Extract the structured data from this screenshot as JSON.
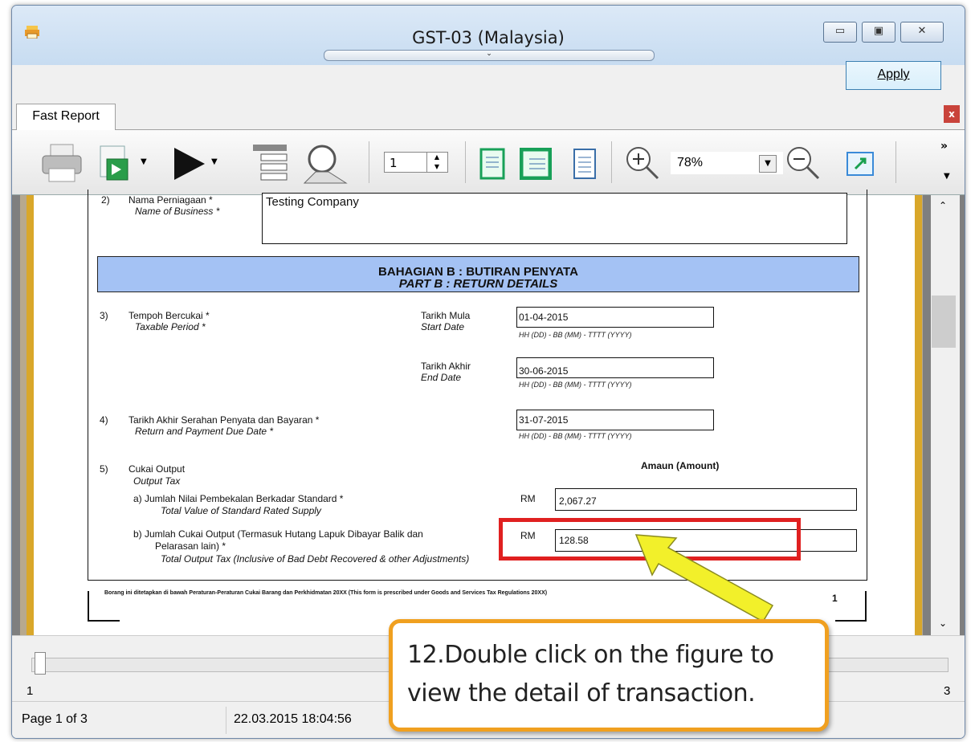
{
  "window": {
    "title": "GST-03 (Malaysia)",
    "minimize": "▭",
    "maximize": "▣",
    "close": "✕"
  },
  "commands": {
    "apply": "Apply"
  },
  "tabs": {
    "active": "Fast Report",
    "close": "x"
  },
  "toolbar": {
    "page_input": "1",
    "zoom": "78%",
    "spin_up": "▲",
    "spin_down": "▼",
    "zoom_dropdown": "▼",
    "overflow": "»",
    "overflow_down": "▼"
  },
  "form": {
    "item2_num": "2)",
    "item2_label_ms": "Nama Perniagaan *",
    "item2_label_en": "Name of Business *",
    "item2_value": "Testing Company",
    "partb_ms": "BAHAGIAN B : BUTIRAN PENYATA",
    "partb_en": "PART B : RETURN DETAILS",
    "item3_num": "3)",
    "item3_label_ms": "Tempoh Bercukai *",
    "item3_label_en": "Taxable Period *",
    "start_label_ms": "Tarikh Mula",
    "start_label_en": "Start Date",
    "start_value": "01-04-2015",
    "date_hint": "HH (DD)  -  BB (MM)  -  TTTT (YYYY)",
    "end_label_ms": "Tarikh Akhir",
    "end_label_en": "End Date",
    "end_value": "30-06-2015",
    "item4_num": "4)",
    "item4_label_ms": "Tarikh Akhir Serahan Penyata dan Bayaran *",
    "item4_label_en": "Return and Payment Due Date *",
    "due_value": "31-07-2015",
    "item5_num": "5)",
    "item5_label_ms": "Cukai Output",
    "item5_label_en": "Output Tax",
    "amount_header": "Amaun (Amount)",
    "a_label_ms": "a)  Jumlah Nilai Pembekalan Berkadar Standard *",
    "a_label_en": "Total Value of Standard Rated Supply",
    "rm": "RM",
    "a_value": "2,067.27",
    "b_label_ms_1": "b)  Jumlah Cukai Output (Termasuk Hutang Lapuk Dibayar Balik dan",
    "b_label_ms_2": "Pelarasan lain) *",
    "b_label_en": "Total Output Tax (Inclusive of Bad Debt Recovered & other Adjustments)",
    "b_value": "128.58",
    "footer_note": "Borang ini ditetapkan di bawah Peraturan-Peraturan Cukai Barang dan Perkhidmatan 20XX (This form is prescribed under Goods and Services Tax Regulations 20XX)",
    "page_num": "1"
  },
  "slider": {
    "min_label": "1",
    "max_label": "3"
  },
  "status": {
    "page": "Page 1 of 3",
    "datetime": "22.03.2015 18:04:56"
  },
  "annotation": {
    "line1": "12.Double click on the figure to",
    "line2": "view the detail of transaction."
  },
  "colors": {
    "highlight_red": "#e02020",
    "arrow_yellow": "#f2f02a",
    "callout_border": "#f0a020",
    "part_header": "#a4c2f4",
    "page_border": "#d9a72a"
  }
}
